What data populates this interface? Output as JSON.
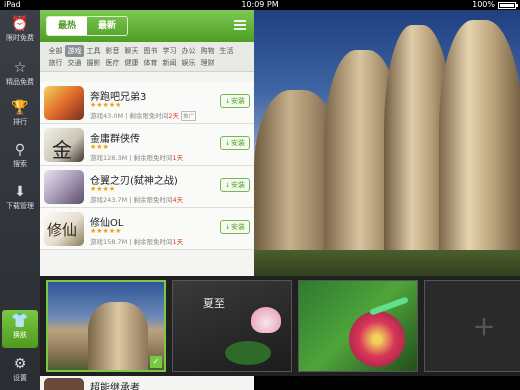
{
  "status": {
    "device": "iPad",
    "time": "10:09 PM",
    "battery": "100%",
    "battery_level": 1.0
  },
  "nav": [
    {
      "label": "限时免费",
      "icon": "alarm-clock-icon"
    },
    {
      "label": "精品免费",
      "icon": "star-icon"
    },
    {
      "label": "排行",
      "icon": "trophy-icon"
    },
    {
      "label": "搜索",
      "icon": "search-icon"
    },
    {
      "label": "下载管理",
      "icon": "download-icon"
    },
    {
      "label": "换肤",
      "icon": "shirt-icon",
      "active": true
    },
    {
      "label": "设置",
      "icon": "gear-icon"
    }
  ],
  "tabs": {
    "hot": "最热",
    "new": "最新",
    "selected": "hot"
  },
  "categories": [
    "全部",
    "游戏",
    "工具",
    "影音",
    "聊天",
    "图书",
    "学习",
    "办公",
    "购物",
    "生活",
    "旅行",
    "交通",
    "摄影",
    "医疗",
    "健康",
    "体育",
    "新闻",
    "娱乐",
    "理财"
  ],
  "selected_category": "游戏",
  "apps": [
    {
      "name": "奔跑吧兄弟3",
      "rating": 4.5,
      "stars": "★★★★★",
      "size": "游戏43.0M",
      "free_text": "剩余限免时间",
      "days": "2天",
      "tag": "推广",
      "install": "安装"
    },
    {
      "name": "金庸群侠传",
      "rating": 2.5,
      "stars": "★★★",
      "size": "游戏128.3M",
      "free_text": "剩余限免时间",
      "days": "1天",
      "tag": "",
      "install": "安装"
    },
    {
      "name": "仓翼之刃(弑神之战)",
      "rating": 4,
      "stars": "★★★★",
      "size": "游戏243.7M",
      "free_text": "剩余限免时间",
      "days": "4天",
      "tag": "",
      "install": "安装"
    },
    {
      "name": "修仙OL",
      "rating": 4.5,
      "stars": "★★★★★",
      "size": "游戏158.7M",
      "free_text": "剩余限免时间",
      "days": "1天",
      "tag": "",
      "install": "安装"
    }
  ],
  "peek_app": {
    "name": "超能继承者"
  },
  "themes": [
    {
      "name": "rocks-theme",
      "selected": true
    },
    {
      "name": "lotus-theme",
      "caption": "夏至"
    },
    {
      "name": "lizard-flower-theme"
    },
    {
      "name": "add-theme",
      "label": "+"
    }
  ],
  "colors": {
    "accent": "#6cbf3c",
    "nav_bg": "#33383d",
    "red": "#d93b20"
  }
}
